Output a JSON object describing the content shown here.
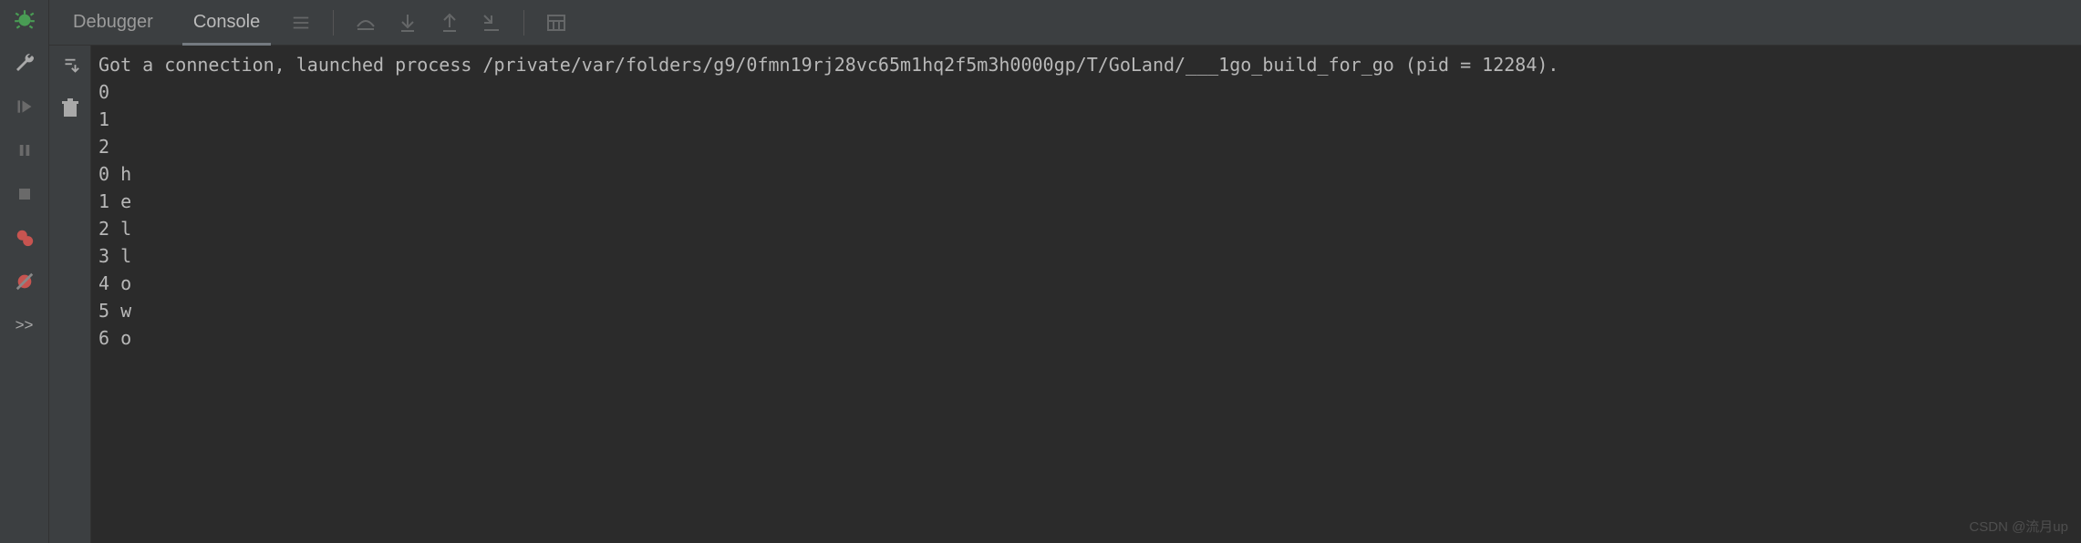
{
  "tabs": {
    "debugger": "Debugger",
    "console": "Console"
  },
  "gutter": {
    "bug": "bug",
    "wrench": "wrench",
    "resume": "resume",
    "pause": "pause",
    "stop": "stop",
    "breakpoints": "breakpoints",
    "mute_bp": "mute-breakpoints",
    "more": ">>"
  },
  "inner_gutter": {
    "scroll_to_end": "scroll-to-end",
    "clear": "clear"
  },
  "toolbar_icons": {
    "list": "list",
    "step_over": "step-over",
    "step_down": "step-down",
    "step_up": "step-up",
    "step_into": "step-into",
    "evaluate": "evaluate"
  },
  "console_lines": [
    "Got a connection, launched process /private/var/folders/g9/0fmn19rj28vc65m1hq2f5m3h0000gp/T/GoLand/___1go_build_for_go (pid = 12284).",
    "0",
    "1",
    "2",
    "0 h",
    "1 e",
    "2 l",
    "3 l",
    "4 o",
    "5 w",
    "6 o"
  ],
  "watermark": "CSDN @流月up"
}
